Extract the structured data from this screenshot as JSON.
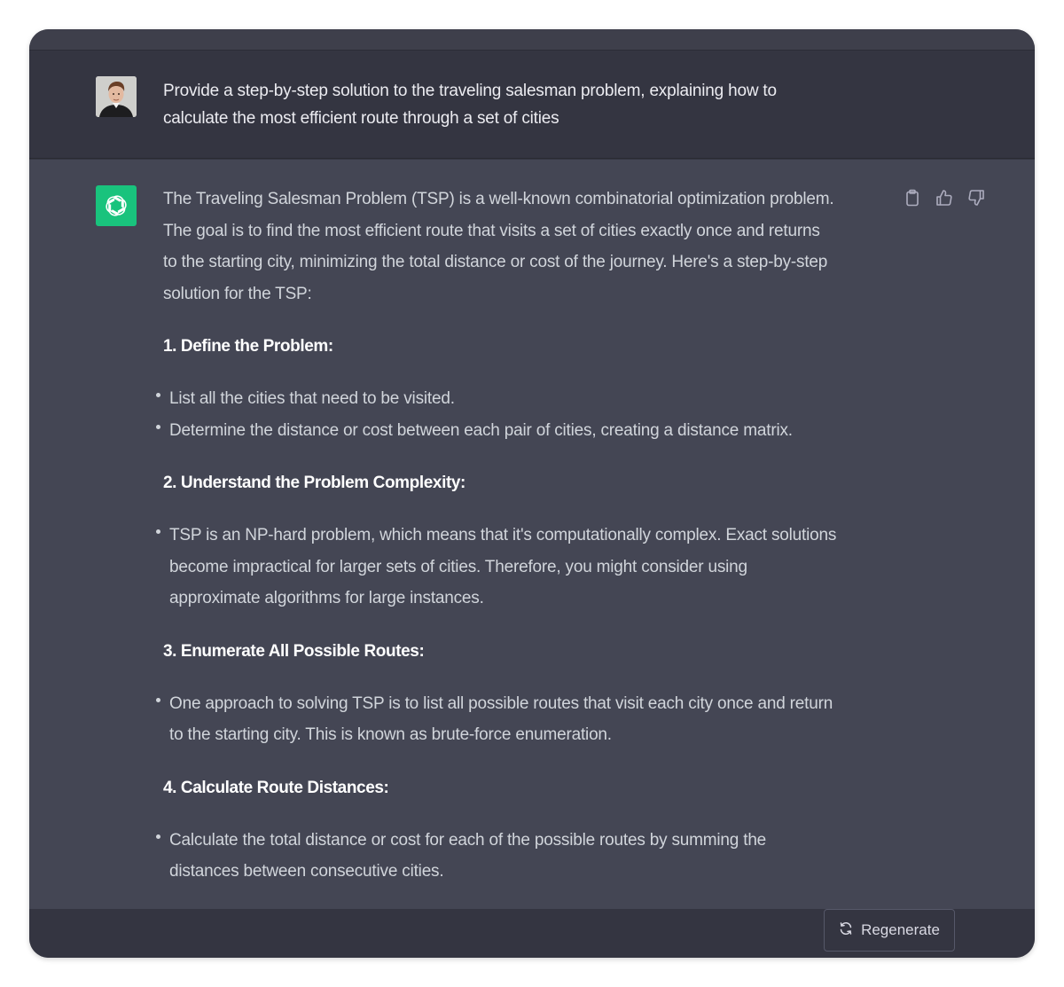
{
  "user_message": {
    "text_line1": "Provide a step-by-step solution to the traveling salesman problem, explaining how to",
    "text_line2": "calculate the most efficient route through a set of cities"
  },
  "assistant_message": {
    "intro": [
      "The Traveling Salesman Problem (TSP) is a well-known combinatorial optimization problem.",
      "The goal is to find the most efficient route that visits a set of cities exactly once and returns",
      "to the starting city, minimizing the total distance or cost of the journey. Here's a step-by-step",
      "solution for the TSP:"
    ],
    "sections": [
      {
        "heading": "1. Define the Problem:",
        "bullets": [
          [
            "List all the cities that need to be visited."
          ],
          [
            "Determine the distance or cost between each pair of cities, creating a distance matrix."
          ]
        ]
      },
      {
        "heading": "2. Understand the Problem Complexity:",
        "bullets": [
          [
            "TSP is an NP-hard problem, which means that it's computationally complex. Exact solutions",
            "become impractical for larger sets of cities. Therefore, you might consider using",
            "approximate algorithms for large instances."
          ]
        ]
      },
      {
        "heading": "3. Enumerate All Possible Routes:",
        "bullets": [
          [
            "One approach to solving TSP is to list all possible routes that visit each city once and return",
            "to the starting city. This is known as brute-force enumeration."
          ]
        ]
      },
      {
        "heading": "4. Calculate Route Distances:",
        "bullets": [
          [
            "Calculate the total distance or cost for each of the possible routes by summing the",
            "distances between consecutive cities."
          ]
        ]
      }
    ],
    "actions": [
      "clipboard-icon",
      "thumbs-up-icon",
      "thumbs-down-icon"
    ]
  },
  "bottom_bar": {
    "regenerate_label": "Regenerate"
  },
  "colors": {
    "accent": "#19c37d",
    "user_bg": "#343541",
    "assistant_bg": "#444654"
  }
}
